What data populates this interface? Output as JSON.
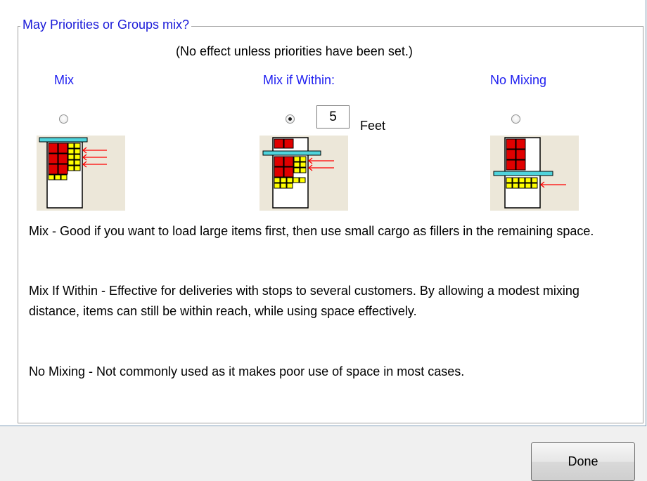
{
  "group": {
    "title": "May Priorities or Groups mix?",
    "note": "(No effect unless priorities have been set.)"
  },
  "options": [
    {
      "label": "Mix",
      "selected": false
    },
    {
      "label": "Mix if Within:",
      "selected": true
    },
    {
      "label": "No Mixing",
      "selected": false
    }
  ],
  "distance": {
    "value": "5",
    "unit": "Feet"
  },
  "descriptions": [
    "Mix - Good if you want to load large items first, then use small cargo as fillers in the remaining space.",
    "Mix If Within - Effective for deliveries with stops to several customers.  By allowing a modest mixing distance, items can still be within reach, while using space effectively.",
    "No Mixing - Not commonly used as it makes poor use of space in most cases."
  ],
  "buttons": {
    "done": "Done"
  },
  "colors": {
    "group_title": "#1a1ad8",
    "option_label": "#1e1ef0",
    "large_cargo": "#e00000",
    "small_cargo": "#ffff00",
    "divider_bar": "#4fd4dc",
    "arrow": "#ff0000",
    "picture_bg": "#ece7d9"
  }
}
